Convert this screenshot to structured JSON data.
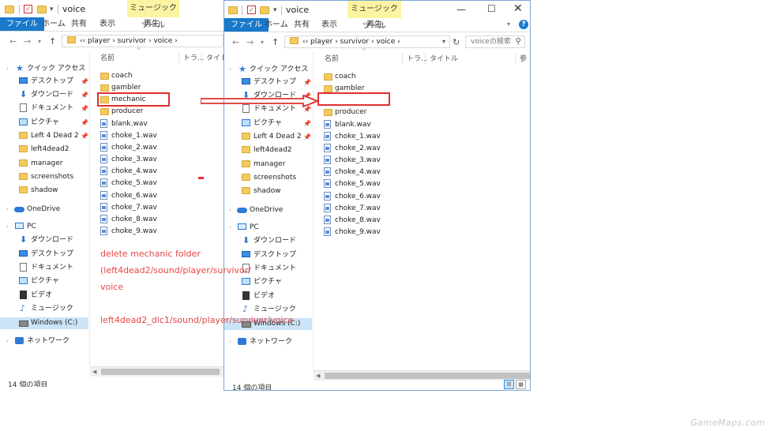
{
  "left_window": {
    "title": "voice",
    "context_tab": "ミュージック ツール",
    "ribbon_tabs": [
      "ファイル",
      "ホーム",
      "共有",
      "表示",
      "再生"
    ],
    "breadcrumb": "‹‹  player  ›  survivor  ›  voice  ›",
    "columns": [
      "名前",
      "トラ...",
      "タイトル"
    ],
    "nav": {
      "quick_access": "クイック アクセス",
      "quick_items": [
        "デスクトップ",
        "ダウンロード",
        "ドキュメント",
        "ピクチャ"
      ],
      "folders": [
        "Left 4 Dead 2",
        "left4dead2",
        "manager",
        "screenshots",
        "shadow"
      ],
      "onedrive": "OneDrive",
      "pc": "PC",
      "pc_items": [
        "ダウンロード",
        "デスクトップ",
        "ドキュメント",
        "ピクチャ",
        "ビデオ",
        "ミュージック",
        "Windows (C:)"
      ],
      "network": "ネットワーク"
    },
    "folders": [
      "coach",
      "gambler",
      "mechanic",
      "producer"
    ],
    "files": [
      "blank.wav",
      "choke_1.wav",
      "choke_2.wav",
      "choke_3.wav",
      "choke_4.wav",
      "choke_5.wav",
      "choke_6.wav",
      "choke_7.wav",
      "choke_8.wav",
      "choke_9.wav"
    ],
    "status": "14 個の項目"
  },
  "right_window": {
    "title": "voice",
    "context_tab": "ミュージック ツール",
    "ribbon_tabs": [
      "ファイル",
      "ホーム",
      "共有",
      "表示",
      "再生"
    ],
    "breadcrumb": "‹‹  player  ›  survivor  ›  voice  ›",
    "search_placeholder": "voiceの検索",
    "columns": [
      "名前",
      "トラ...",
      "タイトル",
      "参"
    ],
    "nav": {
      "quick_access": "クイック アクセス",
      "quick_items": [
        "デスクトップ",
        "ダウンロード",
        "ドキュメント",
        "ピクチャ"
      ],
      "folders": [
        "Left 4 Dead 2",
        "left4dead2",
        "manager",
        "screenshots",
        "shadow"
      ],
      "onedrive": "OneDrive",
      "pc": "PC",
      "pc_items": [
        "ダウンロード",
        "デスクトップ",
        "ドキュメント",
        "ピクチャ",
        "ビデオ",
        "ミュージック",
        "Windows (C:)"
      ],
      "network": "ネットワーク"
    },
    "folders": [
      "coach",
      "gambler",
      "producer"
    ],
    "files": [
      "blank.wav",
      "choke_1.wav",
      "choke_2.wav",
      "choke_3.wav",
      "choke_4.wav",
      "choke_5.wav",
      "choke_6.wav",
      "choke_7.wav",
      "choke_8.wav",
      "choke_9.wav"
    ],
    "status": "14 個の項目"
  },
  "annotation": {
    "line1": "delete   mechanic   folder",
    "line2": "(left4dead2/sound/player/survivor/",
    "line3": "voice",
    "line4": "left4dead2_dlc1/sound/player/survivor/voice",
    "color": "#e64545"
  },
  "watermark": "GameMaps.com",
  "colors": {
    "accent": "#1979ca",
    "highlight": "#e03030",
    "context_tab": "#fcf4a3"
  }
}
